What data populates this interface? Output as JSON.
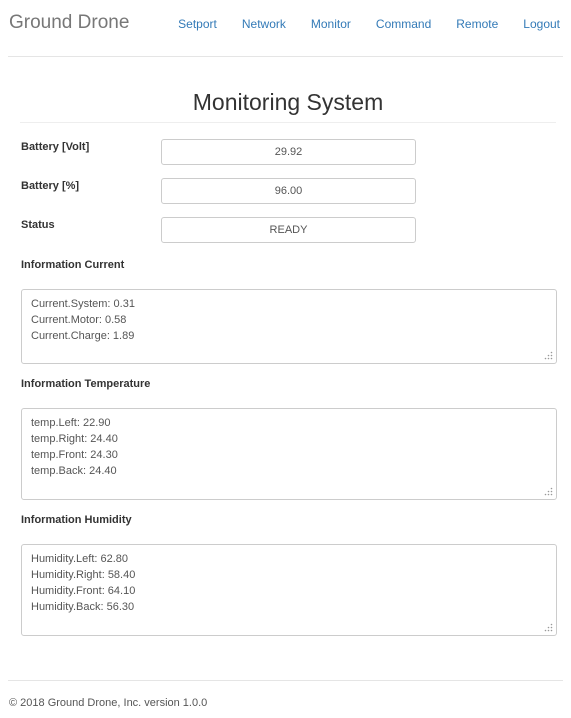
{
  "navbar": {
    "brand": "Ground Drone",
    "links": [
      "Setport",
      "Network",
      "Monitor",
      "Command",
      "Remote",
      "Logout"
    ]
  },
  "page_title": "Monitoring System",
  "fields": [
    {
      "label": "Battery [Volt]",
      "value": "29.92"
    },
    {
      "label": "Battery [%]",
      "value": "96.00"
    },
    {
      "label": "Status",
      "value": "READY"
    }
  ],
  "sections": [
    {
      "label": "Information Current",
      "lines": [
        "Current.System: 0.31",
        "Current.Motor: 0.58",
        "Current.Charge: 1.89"
      ]
    },
    {
      "label": "Information Temperature",
      "lines": [
        "temp.Left: 22.90",
        "temp.Right: 24.40",
        "temp.Front: 24.30",
        "temp.Back: 24.40"
      ]
    },
    {
      "label": "Information Humidity",
      "lines": [
        "Humidity.Left: 62.80",
        "Humidity.Right: 58.40",
        "Humidity.Front: 64.10",
        "Humidity.Back: 56.30"
      ]
    }
  ],
  "footer": "© 2018 Ground Drone, Inc. version 1.0.0"
}
